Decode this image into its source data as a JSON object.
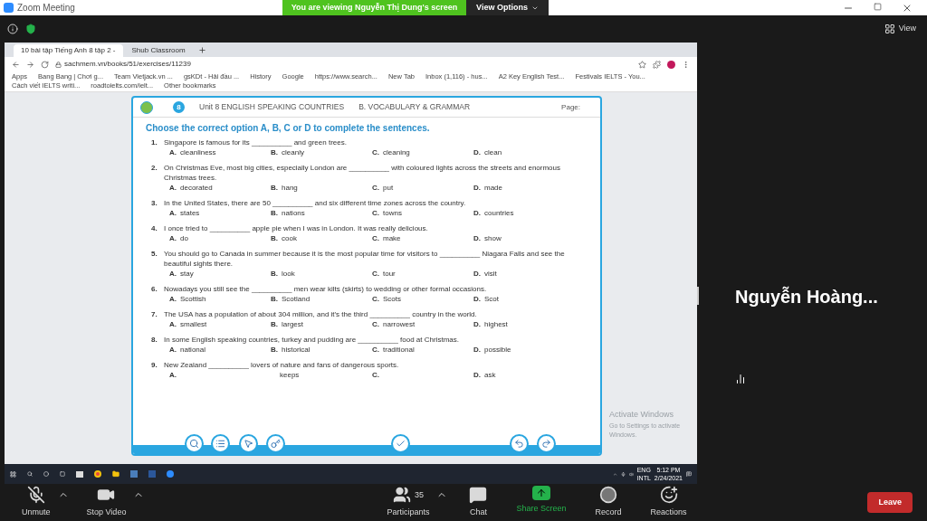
{
  "window": {
    "title": "Zoom Meeting"
  },
  "share_banner": {
    "text": "You are viewing Nguyễn Thị Dung's screen",
    "options": "View Options"
  },
  "view_button": "View",
  "browser": {
    "tabs": [
      {
        "title": "10 bài tập Tiếng Anh 8 tập 2 -",
        "selected": true
      },
      {
        "title": "Shub Classroom",
        "selected": false
      }
    ],
    "url": "sachmem.vn/books/51/exercises/11239",
    "bookmarks": [
      "Apps",
      "Bang Bang | Chơi g...",
      "Team Vietjack.vn ...",
      "gsKDt - Hải đầu ...",
      "History",
      "Google",
      "https://www.search...",
      "New Tab",
      "Inbox (1,116) - hus...",
      "A2 Key English Test...",
      "Festivals IELTS - You...",
      "Cách viết IELTS writi...",
      "roadtoielts.com/ielt...",
      "Other bookmarks"
    ]
  },
  "worksheet": {
    "breadcrumb": [
      "Unit 8 ENGLISH SPEAKING COUNTRIES",
      "B. VOCABULARY & GRAMMAR"
    ],
    "page_label": "Page:",
    "badge": "8",
    "instruction": "Choose the correct option A, B, C or D to complete the sentences.",
    "questions": [
      {
        "number": "1.",
        "text": "Singapore is famous for its __________ and green trees.",
        "options": [
          {
            "letter": "A.",
            "text": "cleanliness"
          },
          {
            "letter": "B.",
            "text": "cleanly"
          },
          {
            "letter": "C.",
            "text": "cleaning"
          },
          {
            "letter": "D.",
            "text": "clean"
          }
        ]
      },
      {
        "number": "2.",
        "text": "On Christmas Eve, most big cities, especially London are __________ with coloured lights across the streets and enormous Christmas trees.",
        "options": [
          {
            "letter": "A.",
            "text": "decorated"
          },
          {
            "letter": "B.",
            "text": "hang"
          },
          {
            "letter": "C.",
            "text": "put"
          },
          {
            "letter": "D.",
            "text": "made"
          }
        ]
      },
      {
        "number": "3.",
        "text": "In the United States, there are 50 __________ and six different time zones across the country.",
        "options": [
          {
            "letter": "A.",
            "text": "states"
          },
          {
            "letter": "B.",
            "text": "nations"
          },
          {
            "letter": "C.",
            "text": "towns"
          },
          {
            "letter": "D.",
            "text": "countries"
          }
        ]
      },
      {
        "number": "4.",
        "text": "I once tried to __________ apple pie when I was in London. It was really delicious.",
        "options": [
          {
            "letter": "A.",
            "text": "do"
          },
          {
            "letter": "B.",
            "text": "cook"
          },
          {
            "letter": "C.",
            "text": "make"
          },
          {
            "letter": "D.",
            "text": "show"
          }
        ]
      },
      {
        "number": "5.",
        "text": "You should go to Canada in summer because it is the most popular time for visitors to __________ Niagara Falls and see the beautiful sights there.",
        "options": [
          {
            "letter": "A.",
            "text": "stay"
          },
          {
            "letter": "B.",
            "text": "look"
          },
          {
            "letter": "C.",
            "text": "tour"
          },
          {
            "letter": "D.",
            "text": "visit"
          }
        ]
      },
      {
        "number": "6.",
        "text": "Nowadays you still see the __________ men wear kilts (skirts) to wedding or other formal occasions.",
        "options": [
          {
            "letter": "A.",
            "text": "Scottish"
          },
          {
            "letter": "B.",
            "text": "Scotland"
          },
          {
            "letter": "C.",
            "text": "Scots"
          },
          {
            "letter": "D.",
            "text": "Scot"
          }
        ]
      },
      {
        "number": "7.",
        "text": "The USA has a population of about 304 million, and it's the third __________ country in the world.",
        "options": [
          {
            "letter": "A.",
            "text": "smallest"
          },
          {
            "letter": "B.",
            "text": "largest"
          },
          {
            "letter": "C.",
            "text": "narrowest"
          },
          {
            "letter": "D.",
            "text": "highest"
          }
        ]
      },
      {
        "number": "8.",
        "text": "In some English speaking countries, turkey and pudding are __________ food at Christmas.",
        "options": [
          {
            "letter": "A.",
            "text": "national"
          },
          {
            "letter": "B.",
            "text": "historical"
          },
          {
            "letter": "C.",
            "text": "traditional"
          },
          {
            "letter": "D.",
            "text": "possible"
          }
        ]
      },
      {
        "number": "9.",
        "text": "New Zealand __________ lovers of nature and fans of dangerous sports.",
        "options": [
          {
            "letter": "A."
          },
          {
            "text": "keeps"
          },
          {
            "letter": "C."
          },
          {
            "letter": "D.",
            "text": "ask"
          }
        ]
      }
    ]
  },
  "activation": {
    "title": "Activate Windows",
    "subtitle": "Go to Settings to activate Windows."
  },
  "taskbar": {
    "lang": [
      "ENG",
      "INTL"
    ],
    "time": "5:12 PM",
    "date": "2/24/2021"
  },
  "participant_name": "Nguyễn  Hoàng...",
  "controls": [
    {
      "kind": "mic",
      "label": "Unmute",
      "caret": true
    },
    {
      "kind": "video",
      "label": "Stop Video",
      "caret": true
    },
    {
      "kind": "participants",
      "label": "Participants",
      "count": "35",
      "caret": true
    },
    {
      "kind": "chat",
      "label": "Chat"
    },
    {
      "kind": "share",
      "label": "Share Screen"
    },
    {
      "kind": "record",
      "label": "Record"
    },
    {
      "kind": "reactions",
      "label": "Reactions"
    }
  ],
  "leave_button": "Leave"
}
